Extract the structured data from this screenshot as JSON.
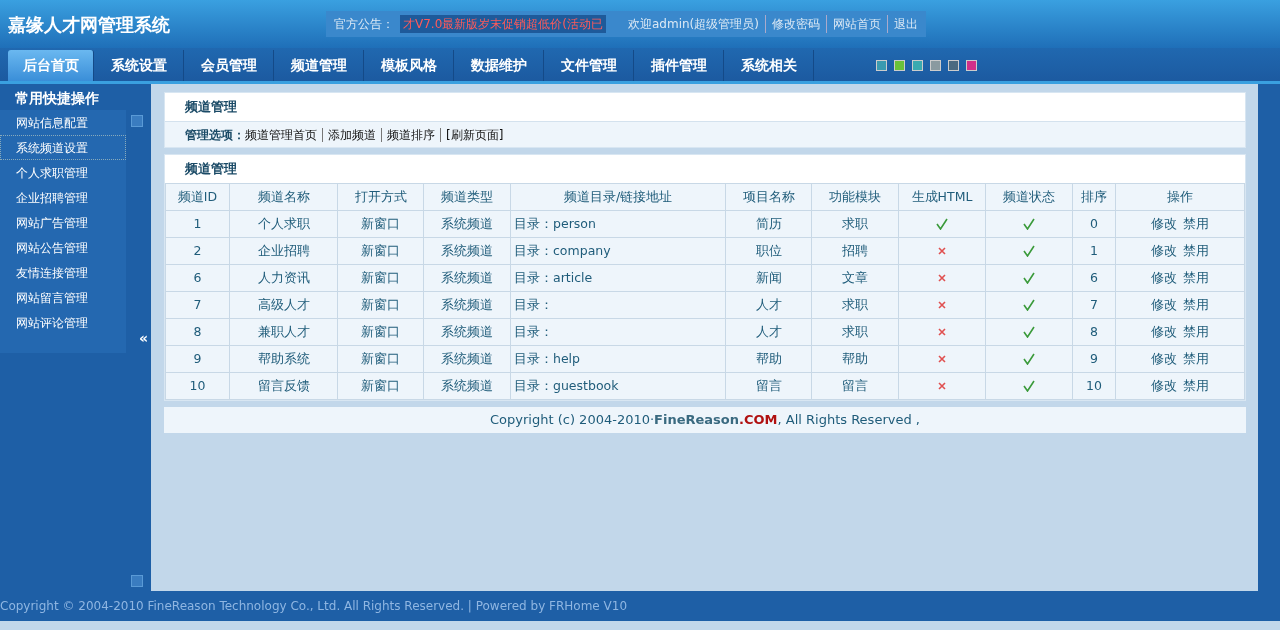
{
  "header": {
    "title": "嘉缘人才网管理系统",
    "notice_label": "官方公告：",
    "notice_text": "才V7.0最新版岁末促销超低价(活动已",
    "welcome": "欢迎admin(超级管理员)",
    "links": [
      "修改密码",
      "网站首页",
      "退出"
    ]
  },
  "nav": {
    "tabs": [
      {
        "label": "后台首页",
        "selected": true
      },
      {
        "label": "系统设置",
        "selected": false
      },
      {
        "label": "会员管理",
        "selected": false
      },
      {
        "label": "频道管理",
        "selected": false
      },
      {
        "label": "模板风格",
        "selected": false
      },
      {
        "label": "数据维护",
        "selected": false
      },
      {
        "label": "文件管理",
        "selected": false
      },
      {
        "label": "插件管理",
        "selected": false
      },
      {
        "label": "系统相关",
        "selected": false
      }
    ],
    "themes": [
      {
        "color": "#3a9ab0"
      },
      {
        "color": "#6ac23a"
      },
      {
        "color": "#3aaab0"
      },
      {
        "color": "#8a9aa0"
      },
      {
        "color": "#4a6a80"
      },
      {
        "color": "#d0308a"
      }
    ]
  },
  "sidebar": {
    "title": "常用快捷操作",
    "items": [
      {
        "label": "网站信息配置",
        "selected": false
      },
      {
        "label": "系统频道设置",
        "selected": true
      },
      {
        "label": "个人求职管理",
        "selected": false
      },
      {
        "label": "企业招聘管理",
        "selected": false
      },
      {
        "label": "网站广告管理",
        "selected": false
      },
      {
        "label": "网站公告管理",
        "selected": false
      },
      {
        "label": "友情连接管理",
        "selected": false
      },
      {
        "label": "网站留言管理",
        "selected": false
      },
      {
        "label": "网站评论管理",
        "selected": false
      }
    ],
    "collapse_button": "«"
  },
  "options_panel": {
    "title": "频道管理",
    "label": "管理选项：",
    "links": [
      "频道管理首页",
      "添加频道",
      "频道排序",
      "[刷新页面]"
    ]
  },
  "table": {
    "title": "频道管理",
    "columns": [
      "频道ID",
      "频道名称",
      "打开方式",
      "频道类型",
      "频道目录/链接地址",
      "项目名称",
      "功能模块",
      "生成HTML",
      "频道状态",
      "排序",
      "操作"
    ],
    "rows": [
      {
        "id": "1",
        "name": "个人求职",
        "open": "新窗口",
        "type": "系统频道",
        "dir": "目录：person",
        "project": "简历",
        "module": "求职",
        "html": true,
        "status": true,
        "sort": "0",
        "actions": [
          "修改",
          "禁用"
        ]
      },
      {
        "id": "2",
        "name": "企业招聘",
        "open": "新窗口",
        "type": "系统频道",
        "dir": "目录：company",
        "project": "职位",
        "module": "招聘",
        "html": false,
        "status": true,
        "sort": "1",
        "actions": [
          "修改",
          "禁用"
        ]
      },
      {
        "id": "6",
        "name": "人力资讯",
        "open": "新窗口",
        "type": "系统频道",
        "dir": "目录：article",
        "project": "新闻",
        "module": "文章",
        "html": false,
        "status": true,
        "sort": "6",
        "actions": [
          "修改",
          "禁用"
        ]
      },
      {
        "id": "7",
        "name": "高级人才",
        "open": "新窗口",
        "type": "系统频道",
        "dir": "目录：",
        "project": "人才",
        "module": "求职",
        "html": false,
        "status": true,
        "sort": "7",
        "actions": [
          "修改",
          "禁用"
        ]
      },
      {
        "id": "8",
        "name": "兼职人才",
        "open": "新窗口",
        "type": "系统频道",
        "dir": "目录：",
        "project": "人才",
        "module": "求职",
        "html": false,
        "status": true,
        "sort": "8",
        "actions": [
          "修改",
          "禁用"
        ]
      },
      {
        "id": "9",
        "name": "帮助系统",
        "open": "新窗口",
        "type": "系统频道",
        "dir": "目录：help",
        "project": "帮助",
        "module": "帮助",
        "html": false,
        "status": true,
        "sort": "9",
        "actions": [
          "修改",
          "禁用"
        ]
      },
      {
        "id": "10",
        "name": "留言反馈",
        "open": "新窗口",
        "type": "系统频道",
        "dir": "目录：guestbook",
        "project": "留言",
        "module": "留言",
        "html": false,
        "status": true,
        "sort": "10",
        "actions": [
          "修改",
          "禁用"
        ]
      }
    ]
  },
  "copyright": {
    "before": "Copyright (c) 2004-2010·",
    "brand": "FineReason",
    "domain": ".COM",
    "after": ", All Rights Reserved ,"
  },
  "status_bar": "Copyright © 2004-2010 FineReason Technology Co., Ltd. All Rights Reserved. | Powered by FRHome V10"
}
